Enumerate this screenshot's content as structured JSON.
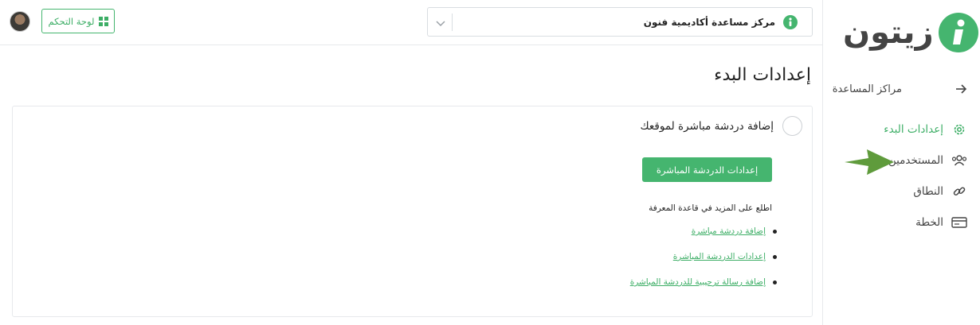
{
  "brand": {
    "name": "زيتون",
    "accent": "#45b56f"
  },
  "topbar": {
    "dashboard_label": "لوحة التحكم",
    "help_center": "مركز مساعدة أكاديمية فنون"
  },
  "sidebar": {
    "back_label": "مراكز المساعدة",
    "items": [
      {
        "label": "إعدادات البدء",
        "icon": "gear-icon",
        "active": true
      },
      {
        "label": "المستخدمين",
        "icon": "users-icon",
        "active": false
      },
      {
        "label": "النطاق",
        "icon": "link-icon",
        "active": false
      },
      {
        "label": "الخطة",
        "icon": "plan-card-icon",
        "active": false
      }
    ]
  },
  "main": {
    "title": "إعدادات البدء",
    "card": {
      "step_title": "إضافة دردشة مباشرة لموقعك",
      "button_label": "إعدادات الدردشة المباشرة",
      "kb_text": "اطلع على المزيد في قاعدة المعرفة",
      "links": [
        "إضافة دردشة مباشرة",
        "إعدادات الدردشة المباشرة",
        "إضافة رسالة ترحيبية للدردشة المباشرة"
      ]
    }
  }
}
